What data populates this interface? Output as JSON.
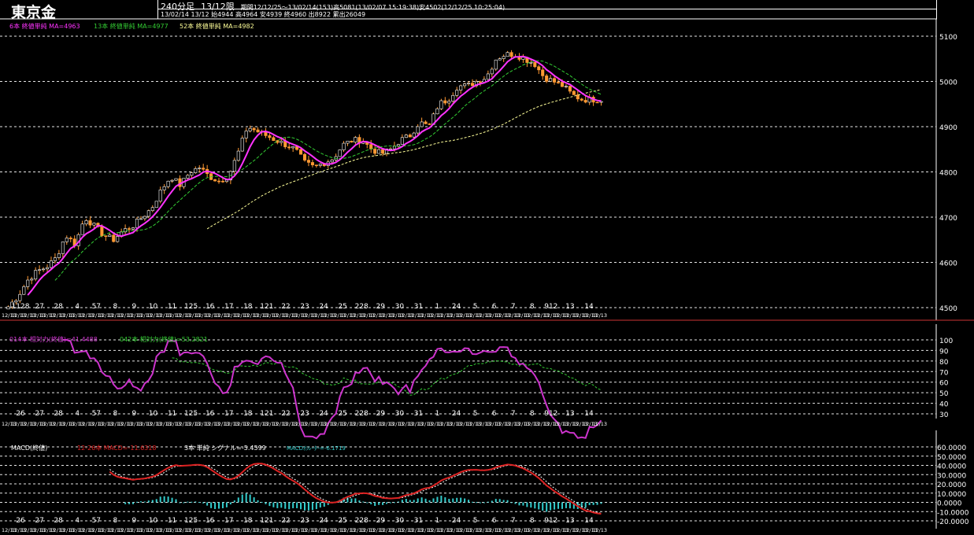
{
  "header": {
    "title": "東京金",
    "timeframe": "240分足",
    "contract": "13/12限",
    "period": "期間12/12/25〜13/02/14(153)高5081(13/02/07 15:19:38)安4502(12/12/25 10:25:04)",
    "ohlc": "13/02/14 13/12 始4944 高4964 安4939 終4960 出8922 累出26049"
  },
  "colors": {
    "ma6": "#ff33ff",
    "ma13": "#33cc33",
    "ma52": "#ffff99",
    "candle": "#ff9933",
    "rsi": "#cc33cc",
    "rsi_long": "#33cc33",
    "macd": "#dd2222",
    "signal": "#ffffff",
    "osc": "#33cccc",
    "grid": "#ffffff"
  },
  "chart_data": [
    {
      "type": "candlestick",
      "name": "price",
      "legend": [
        {
          "label": "6本 終値単純 MA=4963",
          "color_key": "ma6"
        },
        {
          "label": "13本 終値単純 MA=4977",
          "color_key": "ma13"
        },
        {
          "label": "52本 終値単純 MA=4982",
          "color_key": "ma52"
        }
      ],
      "ylim": [
        4500,
        5130
      ],
      "yticks": [
        4500,
        4600,
        4700,
        4800,
        4900,
        5000,
        5100
      ],
      "grid": true,
      "last_close": 4960,
      "close_path": [
        4502,
        4525,
        4560,
        4580,
        4590,
        4610,
        4660,
        4640,
        4700,
        4680,
        4660,
        4650,
        4670,
        4680,
        4700,
        4720,
        4760,
        4790,
        4770,
        4800,
        4810,
        4790,
        4780,
        4790,
        4840,
        4900,
        4890,
        4880,
        4870,
        4860,
        4850,
        4820,
        4810,
        4820,
        4830,
        4860,
        4870,
        4870,
        4850,
        4840,
        4850,
        4870,
        4880,
        4910,
        4900,
        4950,
        4960,
        4990,
        4990,
        5000,
        5010,
        5050,
        5060,
        5060,
        5050,
        5040,
        5010,
        5000,
        4990,
        4970,
        4960,
        4960,
        4960
      ]
    },
    {
      "type": "line",
      "name": "rsi",
      "legend": [
        {
          "label": "014本 相対力(終値)=41.4488",
          "color_key": "rsi"
        },
        {
          "label": "042本 相対力(終値)=53.2821",
          "color_key": "rsi_long"
        }
      ],
      "ylim": [
        30,
        100
      ],
      "yticks": [
        30,
        40,
        50,
        60,
        70,
        80,
        90,
        100
      ],
      "grid": true,
      "last_value": 41.4488
    },
    {
      "type": "line",
      "name": "macd",
      "legend_prefix": "MACD(終値)",
      "legend": [
        {
          "label": "12-26本 MACD=-11.6318",
          "color_key": "macd"
        },
        {
          "label": "3本 単純 シグナル=-5.4599",
          "color_key": "signal"
        },
        {
          "label": "MACDｵｼﾚｰﾀｰ=-6.1719",
          "color_key": "osc"
        }
      ],
      "ylim": [
        -20,
        60
      ],
      "yticks": [
        60,
        50,
        40,
        30,
        20,
        10,
        0,
        -10,
        -20
      ],
      "ytick_labels": [
        "60.0000",
        "50.0000",
        "40.0000",
        "30.0000",
        "20.0000",
        "10.0000",
        "0.0000",
        "-10.0000",
        "-20.0000"
      ],
      "grid": true,
      "last_value": -11.6318
    }
  ],
  "x_axis": {
    "date_labels": [
      "26",
      "27",
      "28",
      "4",
      "57",
      "8",
      "9",
      "10",
      "11",
      "125",
      "16",
      "17",
      "18",
      "121",
      "22",
      "23",
      "24",
      "25",
      "228",
      "29",
      "30",
      "31",
      "1",
      "24",
      "5",
      "6",
      "7",
      "8",
      "912",
      "13",
      "14"
    ],
    "first_date_label_price": "1128",
    "row_label": "12/13"
  }
}
